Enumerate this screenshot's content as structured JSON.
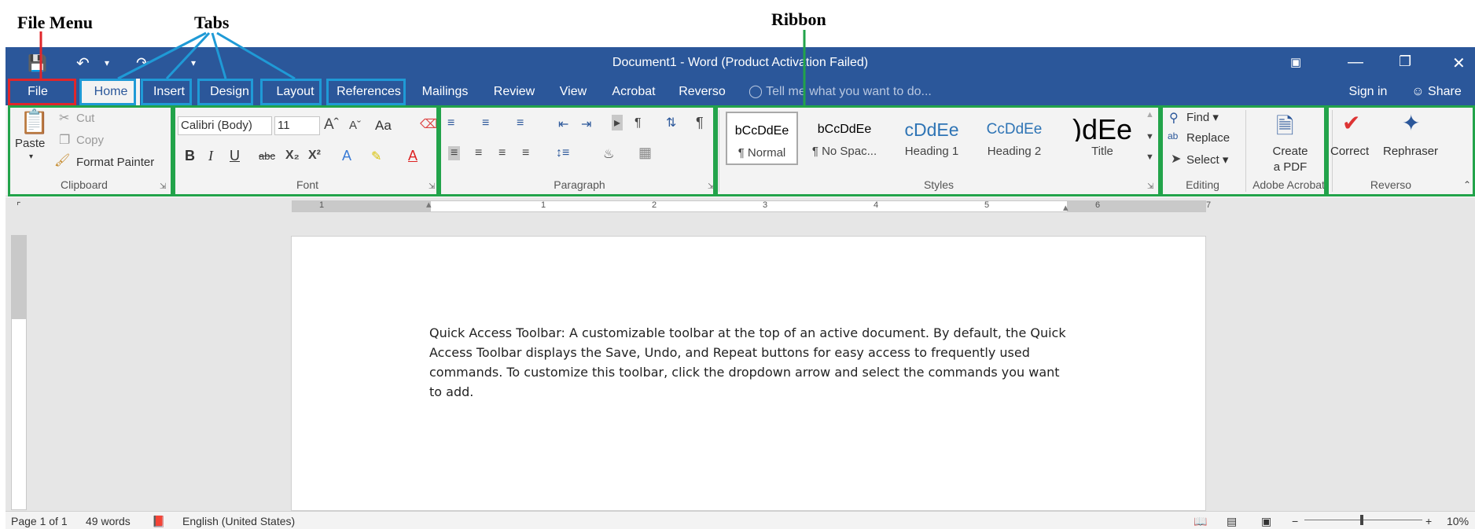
{
  "annotations": {
    "file_menu": "File Menu",
    "tabs": "Tabs",
    "ribbon": "Ribbon"
  },
  "titlebar": {
    "title": "Document1 - Word (Product Activation Failed)",
    "undo_dropdown": "▾",
    "customize": "▾"
  },
  "tabs": [
    "File",
    "Home",
    "Insert",
    "Design",
    "Layout",
    "References",
    "Mailings",
    "Review",
    "View",
    "Acrobat",
    "Reverso"
  ],
  "tell_me": "Tell me what you want to do...",
  "account": {
    "sign_in": "Sign in",
    "share": "Share"
  },
  "clipboard": {
    "paste": "Paste",
    "cut": "Cut",
    "copy": "Copy",
    "format_painter": "Format Painter",
    "label": "Clipboard"
  },
  "font": {
    "name": "Calibri (Body)",
    "size": "11",
    "change_case": "Aa",
    "bold": "B",
    "italic": "I",
    "underline": "U",
    "strike": "abc",
    "label": "Font"
  },
  "paragraph": {
    "label": "Paragraph"
  },
  "styles": {
    "items": [
      {
        "sample": "bCcDdEe",
        "name": "¶ Normal"
      },
      {
        "sample": "bCcDdEe",
        "name": "¶ No Spac..."
      },
      {
        "sample": "cDdEe",
        "name": "Heading 1"
      },
      {
        "sample": "CcDdEe",
        "name": "Heading 2"
      },
      {
        "sample": ")dEe",
        "name": "Title"
      }
    ],
    "label": "Styles"
  },
  "editing": {
    "find": "Find",
    "replace": "Replace",
    "select": "Select",
    "label": "Editing"
  },
  "acrobat": {
    "create_line1": "Create",
    "create_line2": "a PDF",
    "label": "Adobe Acrobat"
  },
  "reverso": {
    "correct": "Correct",
    "rephraser": "Rephraser",
    "label": "Reverso"
  },
  "ruler": {
    "numbers": [
      "1",
      "1",
      "2",
      "3",
      "4",
      "5",
      "6",
      "7"
    ]
  },
  "document": {
    "text": "Quick Access Toolbar: A customizable toolbar at the top of an active document. By default, the Quick Access Toolbar displays the Save, Undo, and Repeat buttons for easy access to frequently used commands. To customize this toolbar, click the dropdown arrow and select the commands you want to add."
  },
  "status": {
    "page": "Page 1 of 1",
    "words": "49 words",
    "language": "English (United States)",
    "zoom": "10%"
  },
  "colors": {
    "title_blue": "#2b579a",
    "file_frame": "#e0262a",
    "tab_frame": "#1f9ad6",
    "ribbon_frame": "#22a34a"
  }
}
